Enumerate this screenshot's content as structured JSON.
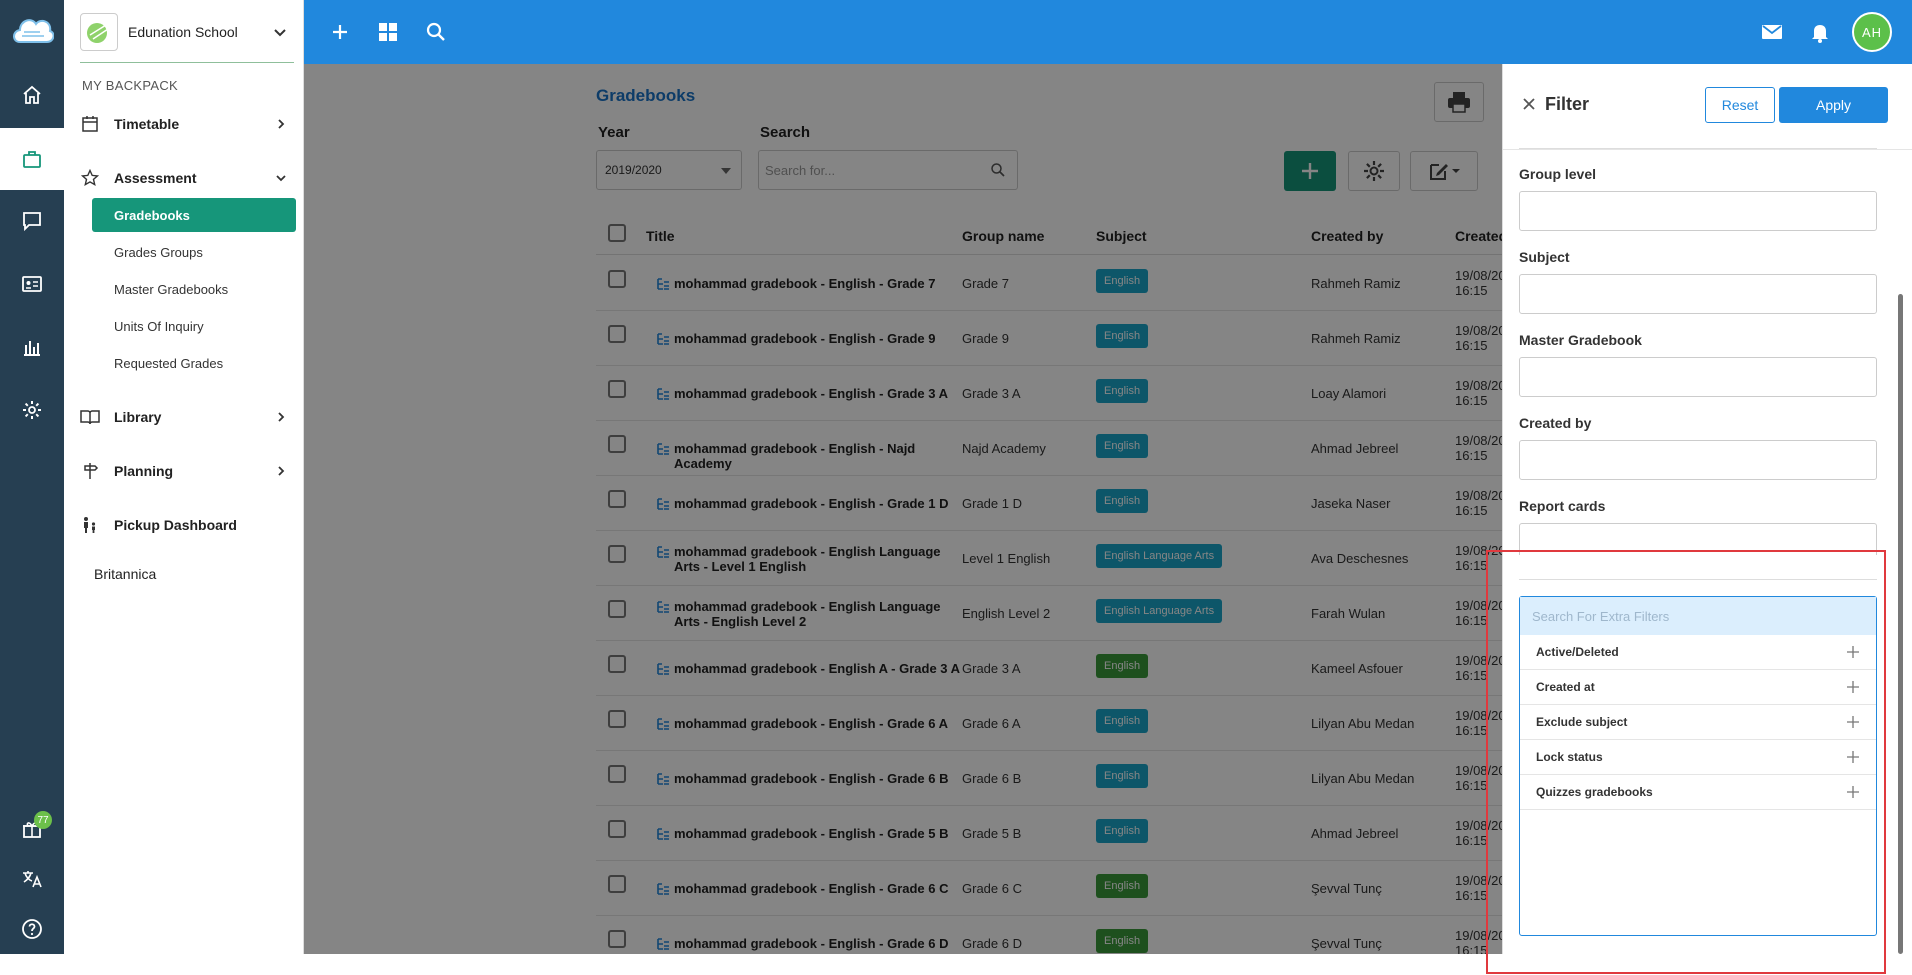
{
  "school": {
    "name": "Edunation School"
  },
  "sidebar": {
    "section_label": "MY BACKPACK",
    "items": [
      {
        "label": "Timetable"
      },
      {
        "label": "Assessment"
      },
      {
        "label": "Library"
      },
      {
        "label": "Planning"
      },
      {
        "label": "Pickup Dashboard"
      }
    ],
    "assessment_sub": [
      {
        "label": "Gradebooks"
      },
      {
        "label": "Grades Groups"
      },
      {
        "label": "Master Gradebooks"
      },
      {
        "label": "Units Of Inquiry"
      },
      {
        "label": "Requested Grades"
      }
    ],
    "extra_link": "Britannica"
  },
  "rail": {
    "gift_badge": "77"
  },
  "topbar": {
    "avatar_initials": "AH"
  },
  "main": {
    "title": "Gradebooks",
    "year_label": "Year",
    "year_value": "2019/2020",
    "search_label": "Search",
    "search_placeholder": "Search for...",
    "columns": [
      "Title",
      "Group name",
      "Subject",
      "Created by",
      "Created"
    ],
    "rows": [
      {
        "title": "mohammad gradebook - English - Grade 7",
        "group": "Grade 7",
        "subject": "English",
        "subject_color": "teal",
        "created_by": "Rahmeh Ramiz",
        "date": "19/08/20",
        "time": "16:15"
      },
      {
        "title": "mohammad gradebook - English - Grade 9",
        "group": "Grade 9",
        "subject": "English",
        "subject_color": "teal",
        "created_by": "Rahmeh Ramiz",
        "date": "19/08/20",
        "time": "16:15"
      },
      {
        "title": "mohammad gradebook - English - Grade 3 A",
        "group": "Grade 3 A",
        "subject": "English",
        "subject_color": "teal",
        "created_by": "Loay Alamori",
        "date": "19/08/20",
        "time": "16:15"
      },
      {
        "title": "mohammad gradebook - English - Najd Academy",
        "group": "Najd Academy",
        "subject": "English",
        "subject_color": "teal",
        "created_by": "Ahmad Jebreel",
        "date": "19/08/20",
        "time": "16:15"
      },
      {
        "title": "mohammad gradebook - English - Grade 1 D",
        "group": "Grade 1 D",
        "subject": "English",
        "subject_color": "teal",
        "created_by": "Jaseka Naser",
        "date": "19/08/20",
        "time": "16:15"
      },
      {
        "title": "mohammad gradebook - English Language Arts - Level 1 English",
        "group": "Level 1 English",
        "subject": "English Language Arts",
        "subject_color": "teal",
        "created_by": "Ava Deschesnes",
        "date": "19/08/20",
        "time": "16:15"
      },
      {
        "title": "mohammad gradebook - English Language Arts - English Level 2",
        "group": "English Level 2",
        "subject": "English Language Arts",
        "subject_color": "teal",
        "created_by": "Farah Wulan",
        "date": "19/08/20",
        "time": "16:15"
      },
      {
        "title": "mohammad gradebook - English A - Grade 3 A",
        "group": "Grade 3 A",
        "subject": "English",
        "subject_color": "green",
        "created_by": "Kameel Asfouer",
        "date": "19/08/20",
        "time": "16:15"
      },
      {
        "title": "mohammad gradebook - English - Grade 6 A",
        "group": "Grade 6 A",
        "subject": "English",
        "subject_color": "teal",
        "created_by": "Lilyan Abu Medan",
        "date": "19/08/20",
        "time": "16:15"
      },
      {
        "title": "mohammad gradebook - English - Grade 6 B",
        "group": "Grade 6 B",
        "subject": "English",
        "subject_color": "teal",
        "created_by": "Lilyan Abu Medan",
        "date": "19/08/20",
        "time": "16:15"
      },
      {
        "title": "mohammad gradebook - English - Grade 5 B",
        "group": "Grade 5 B",
        "subject": "English",
        "subject_color": "teal",
        "created_by": "Ahmad Jebreel",
        "date": "19/08/20",
        "time": "16:15"
      },
      {
        "title": "mohammad gradebook - English - Grade 6 C",
        "group": "Grade 6 C",
        "subject": "English",
        "subject_color": "green",
        "created_by": "Şevval Tunç",
        "date": "19/08/20",
        "time": "16:15"
      },
      {
        "title": "mohammad gradebook - English - Grade 6 D",
        "group": "Grade 6 D",
        "subject": "English",
        "subject_color": "green",
        "created_by": "Şevval Tunç",
        "date": "19/08/20",
        "time": "16:15"
      }
    ]
  },
  "filter": {
    "title": "Filter",
    "reset_label": "Reset",
    "apply_label": "Apply",
    "fields": [
      {
        "label": "Group level"
      },
      {
        "label": "Subject"
      },
      {
        "label": "Master Gradebook"
      },
      {
        "label": "Created by"
      },
      {
        "label": "Report cards"
      }
    ],
    "extra_search_placeholder": "Search For Extra Filters",
    "extra_options": [
      {
        "label": "Active/Deleted"
      },
      {
        "label": "Created at"
      },
      {
        "label": "Exclude subject"
      },
      {
        "label": "Lock status"
      },
      {
        "label": "Quizzes gradebooks"
      }
    ]
  },
  "colors": {
    "primary": "#2188dd",
    "accent_green": "#16967a",
    "rail": "#263f52",
    "highlight": "#e0393e"
  }
}
